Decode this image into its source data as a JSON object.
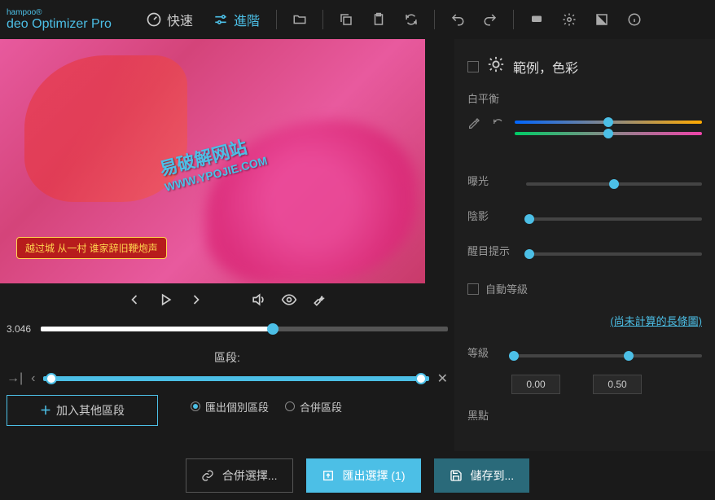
{
  "header": {
    "brand": "hampoo®",
    "product": "deo Optimizer Pro",
    "mode_fast": "快速",
    "mode_advanced": "進階"
  },
  "preview": {
    "watermark_line1": "易破解网站",
    "watermark_line2": "WWW.YPOJIE.COM",
    "subtitle": "越过城 从一村  谁家辞旧鞭炮声"
  },
  "playback": {
    "time": "3.046"
  },
  "segment": {
    "label": "區段:",
    "add_btn": "加入其他區段",
    "export_individual": "匯出個別區段",
    "merge": "合併區段"
  },
  "panel": {
    "title": "範例，色彩",
    "white_balance": "白平衡",
    "exposure": "曝光",
    "shadow": "陰影",
    "highlight": "醒目提示",
    "auto_level": "自動等級",
    "histogram_link": "(尚未計算的長條圖)",
    "level": "等級",
    "level_val1": "0.00",
    "level_val2": "0.50",
    "black_point": "黑點"
  },
  "footer": {
    "merge_select": "合併選擇...",
    "export_select": "匯出選擇 (1)",
    "save_to": "儲存到..."
  }
}
